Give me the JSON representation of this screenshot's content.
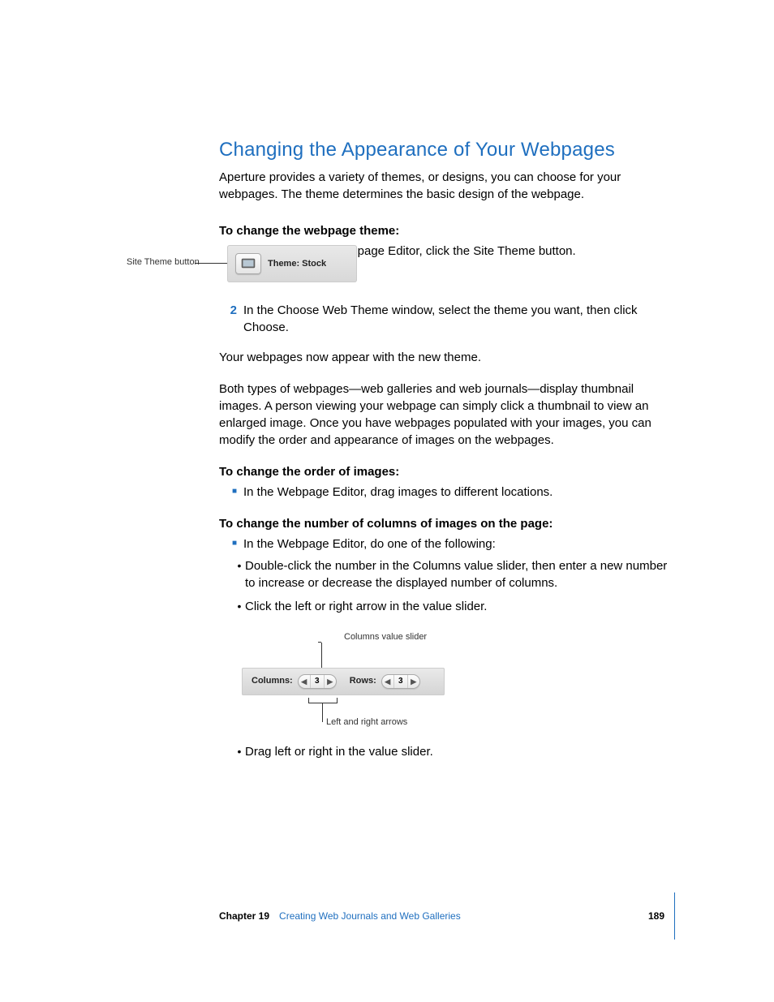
{
  "heading": "Changing the Appearance of Your Webpages",
  "intro": "Aperture provides a variety of themes, or designs, you can choose for your webpages. The theme determines the basic design of the webpage.",
  "task1_title": "To change the webpage theme:",
  "steps": {
    "1": "At the top of the Webpage Editor, click the Site Theme button.",
    "2": "In the Choose Web Theme window, select the theme you want, then click Choose."
  },
  "result_line": "Your webpages now appear with the new theme.",
  "paragraph2": "Both types of webpages—web galleries and web journals—display thumbnail images. A person viewing your webpage can simply click a thumbnail to view an enlarged image. Once you have webpages populated with your images, you can modify the order and appearance of images on the webpages.",
  "task2_title": "To change the order of images:",
  "task2_bullet": "In the Webpage Editor, drag images to different locations.",
  "task3_title": "To change the number of columns of images on the page:",
  "task3_bullet": "In the Webpage Editor, do one of the following:",
  "sub_bullets": {
    "a": "Double-click the number in the Columns value slider, then enter a new number to increase or decrease the displayed number of columns.",
    "b": "Click the left or right arrow in the value slider.",
    "c": "Drag left or right in the value slider."
  },
  "callouts": {
    "site_theme_button": "Site Theme button",
    "columns_value_slider": "Columns value slider",
    "left_right_arrows": "Left and right arrows"
  },
  "fig1": {
    "theme_label": "Theme: Stock"
  },
  "fig2": {
    "columns_label": "Columns:",
    "columns_value": "3",
    "rows_label": "Rows:",
    "rows_value": "3"
  },
  "footer": {
    "chapter": "Chapter 19",
    "title": "Creating Web Journals and Web Galleries",
    "page": "189"
  }
}
